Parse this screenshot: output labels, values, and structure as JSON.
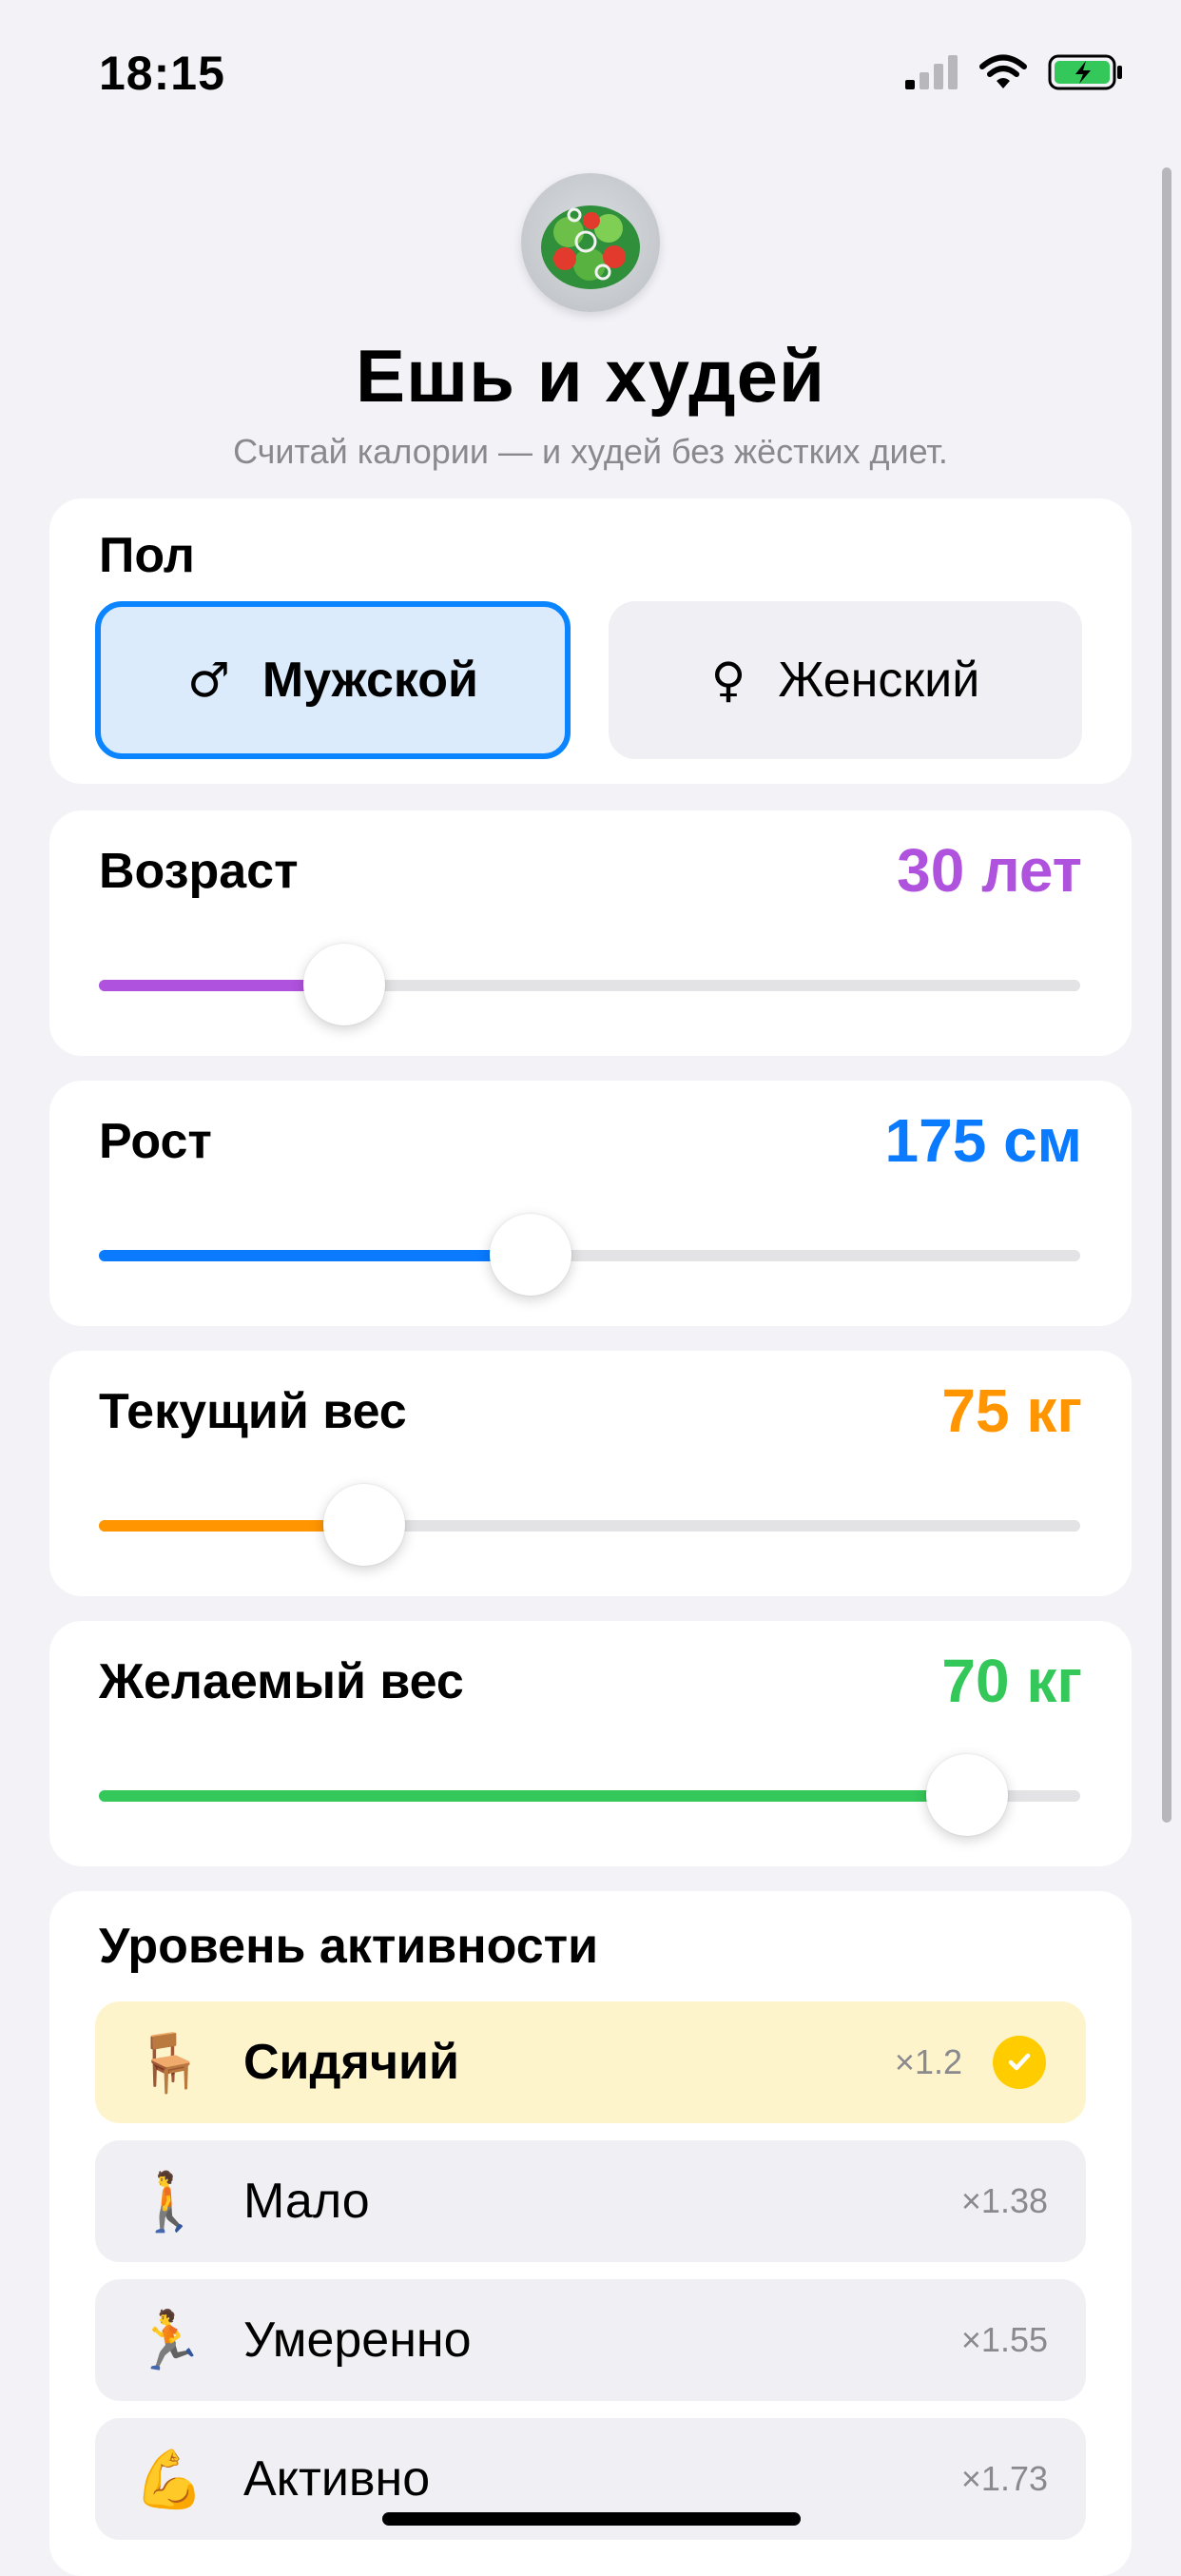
{
  "status_bar": {
    "time": "18:15"
  },
  "header": {
    "title": "Ешь и худей",
    "subtitle": "Считай калории — и худей без жёстких диет."
  },
  "gender": {
    "label": "Пол",
    "options": [
      {
        "label": "Мужской",
        "symbol": "♂",
        "selected": true
      },
      {
        "label": "Женский",
        "symbol": "♀",
        "selected": false
      }
    ]
  },
  "sliders": {
    "age": {
      "label": "Возраст",
      "value_text": "30 лет",
      "value": 30,
      "fraction": 0.25,
      "color": "#af52de"
    },
    "height": {
      "label": "Рост",
      "value_text": "175 см",
      "value": 175,
      "fraction": 0.44,
      "color": "#0a7aff"
    },
    "current_weight": {
      "label": "Текущий вес",
      "value_text": "75 кг",
      "value": 75,
      "fraction": 0.27,
      "color": "#ff9500"
    },
    "target_weight": {
      "label": "Желаемый вес",
      "value_text": "70 кг",
      "value": 70,
      "fraction": 0.885,
      "color": "#34c759"
    }
  },
  "activity": {
    "label": "Уровень активности",
    "items": [
      {
        "emoji": "🪑",
        "label": "Сидячий",
        "multiplier": "×1.2",
        "selected": true
      },
      {
        "emoji": "🚶",
        "label": "Мало",
        "multiplier": "×1.38",
        "selected": false
      },
      {
        "emoji": "🏃",
        "label": "Умеренно",
        "multiplier": "×1.55",
        "selected": false
      },
      {
        "emoji": "💪",
        "label": "Активно",
        "multiplier": "×1.73",
        "selected": false
      }
    ]
  },
  "colors": {
    "accent": "#0a84ff",
    "selected_activity_bg": "#fdf4cc",
    "check": "#ffcc00"
  }
}
